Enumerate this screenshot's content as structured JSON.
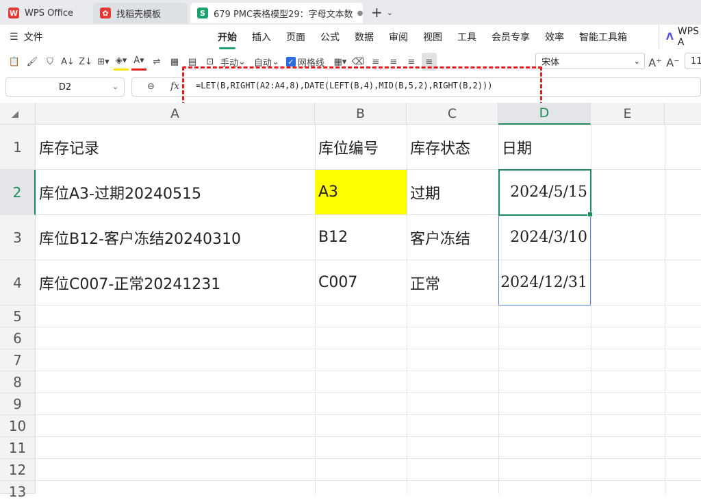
{
  "tabs": [
    {
      "label": "WPS Office",
      "icon": "wps-logo-icon",
      "color": "#e53935"
    },
    {
      "label": "找稻壳模板",
      "icon": "docer-icon",
      "color": "#e53935"
    },
    {
      "label": "679 PMC表格模型29：字母文本数",
      "icon": "sheet-icon",
      "color": "#1aa36f",
      "icon_text": "S"
    }
  ],
  "file_menu": "文件",
  "menu_items": [
    "开始",
    "插入",
    "页面",
    "公式",
    "数据",
    "审阅",
    "视图",
    "工具",
    "会员专享",
    "效率",
    "智能工具箱"
  ],
  "wps_ai_label": "WPS A",
  "toolbar": {
    "manual_label": "手动",
    "auto_label": "自动",
    "gridlines_label": "网格线",
    "font_name": "宋体",
    "font_size": "11"
  },
  "name_box": "D2",
  "formula": "=LET(B,RIGHT(A2:A4,8),DATE(LEFT(B,4),MID(B,5,2),RIGHT(B,2)))",
  "columns": [
    "A",
    "B",
    "C",
    "D",
    "E"
  ],
  "rows": [
    "1",
    "2",
    "3",
    "4",
    "5",
    "6",
    "7",
    "8",
    "9",
    "10",
    "11",
    "12",
    "13"
  ],
  "cells": {
    "A1": "库存记录",
    "B1": "库位编号",
    "C1": "库存状态",
    "D1": "日期",
    "A2": "库位A3-过期20240515",
    "B2": "A3",
    "C2": "过期",
    "D2": "2024/5/15",
    "A3": "库位B12-客户冻结20240310",
    "B3": "B12",
    "C3": "客户冻结",
    "D3": "2024/3/10",
    "A4": "库位C007-正常20241231",
    "B4": "C007",
    "C4": "正常",
    "D4": "2024/12/31"
  },
  "colors": {
    "accent": "#1f8a5c",
    "highlight": "#ffff00",
    "annotation": "#e02020"
  }
}
